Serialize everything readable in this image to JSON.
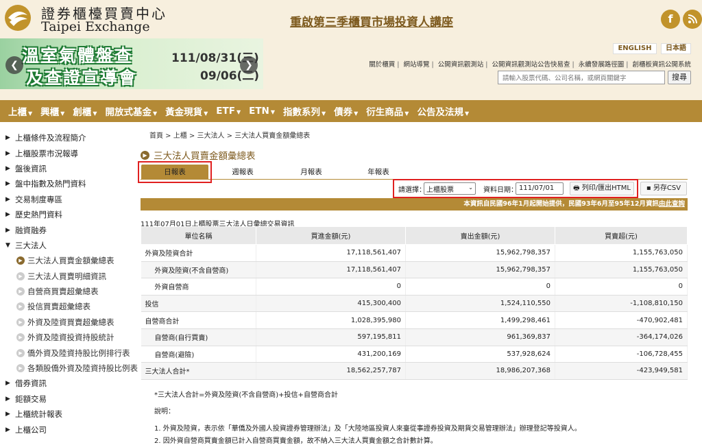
{
  "header": {
    "logo_cn": "證券櫃檯買賣中心",
    "logo_en": "Taipei Exchange",
    "banner_link": "重啟第三季櫃買市場投資人講座",
    "social": {
      "facebook": "f",
      "rss": "rss-icon"
    },
    "promo": {
      "line1": "溫室氣體盤查",
      "line2": "及查證宣導會",
      "date1": "111/08/31(三)",
      "date2": "09/06(二)"
    },
    "lang_en": "ENGLISH",
    "lang_jp": "日本語",
    "util_links": [
      "關於櫃買",
      "網站導覽",
      "公開資訊觀測站",
      "公開資訊觀測站公告快易查",
      "永續發展路徑圖",
      "創櫃板資訊公開系統"
    ],
    "search_placeholder": "請輸入股票代碼、公司名稱，或網頁關鍵字",
    "search_button": "搜尋"
  },
  "nav": [
    {
      "label": "上櫃"
    },
    {
      "label": "興櫃"
    },
    {
      "label": "創櫃"
    },
    {
      "label": "開放式基金"
    },
    {
      "label": "黃金現貨"
    },
    {
      "label": "ETF"
    },
    {
      "label": "ETN"
    },
    {
      "label": "指數系列"
    },
    {
      "label": "債券"
    },
    {
      "label": "衍生商品"
    },
    {
      "label": "公告及法規"
    }
  ],
  "sidebar": {
    "top_items": [
      "上櫃條件及流程簡介",
      "上櫃股票市況報導",
      "盤後資訊",
      "盤中指數及熱門資料",
      "交易制度專區",
      "歷史熱門資料",
      "融資融券"
    ],
    "open_item": "三大法人",
    "sub_items": [
      "三大法人買賣金額彙總表",
      "三大法人買賣明細資訊",
      "自營商買賣超彙總表",
      "投信買賣超彙總表",
      "外資及陸資買賣超彙總表",
      "外資及陸資投資持股統計",
      "僑外資及陸資持股比例排行表",
      "各類股僑外資及陸資持股比例表"
    ],
    "bottom_items": [
      "借券資訊",
      "鉅額交易",
      "上櫃統計報表",
      "上櫃公司"
    ]
  },
  "main": {
    "breadcrumb": "首頁 > 上櫃 > 三大法人 > 三大法人買賣金額彙總表",
    "title": "三大法人買賣金額彙總表",
    "tabs": [
      "日報表",
      "週報表",
      "月報表",
      "年報表"
    ],
    "filter_label": "請選擇：",
    "market_value": "上櫃股票",
    "date_label": "資料日期：",
    "date_value": "111/07/01",
    "print_button": "列印/匯出HTML",
    "csv_button": "另存CSV",
    "info_text": "本資訊自民國96年1月起開始提供，民國93年6月至95年12月資訊",
    "info_link": "由此查詢",
    "table_caption": "111年07月01日上櫃股票三大法人日彙總交易資訊",
    "columns": [
      "單位名稱",
      "買進金額(元)",
      "賣出金額(元)",
      "買賣超(元)"
    ],
    "rows": [
      [
        "外資及陸資合計",
        "17,118,561,407",
        "15,962,798,357",
        "1,155,763,050"
      ],
      [
        "外資及陸資(不含自營商)",
        "17,118,561,407",
        "15,962,798,357",
        "1,155,763,050"
      ],
      [
        "外資自營商",
        "0",
        "0",
        "0"
      ],
      [
        "投信",
        "415,300,400",
        "1,524,110,550",
        "-1,108,810,150"
      ],
      [
        "自營商合計",
        "1,028,395,980",
        "1,499,298,461",
        "-470,902,481"
      ],
      [
        "自營商(自行買賣)",
        "597,195,811",
        "961,369,837",
        "-364,174,026"
      ],
      [
        "自營商(避險)",
        "431,200,169",
        "537,928,624",
        "-106,728,455"
      ],
      [
        "三大法人合計*",
        "18,562,257,787",
        "18,986,207,368",
        "-423,949,581"
      ]
    ],
    "footnote": "*三大法人合計=外資及陸資(不含自營商)+投信+自營商合計",
    "note_title": "說明：",
    "note_1": "1. 外資及陸資，表示依「華僑及外國人投資證券管理辦法」及「大陸地區投資人來臺從事證券投資及期貨交易管理辦法」辦理登記等投資人。",
    "note_2": "2. 因外資自營商買賣金額已計入自營商買賣金額，故不納入三大法人買賣金額之合計數計算。"
  },
  "colors": {
    "brand": "#b48a36",
    "highlight": "#e02020"
  }
}
